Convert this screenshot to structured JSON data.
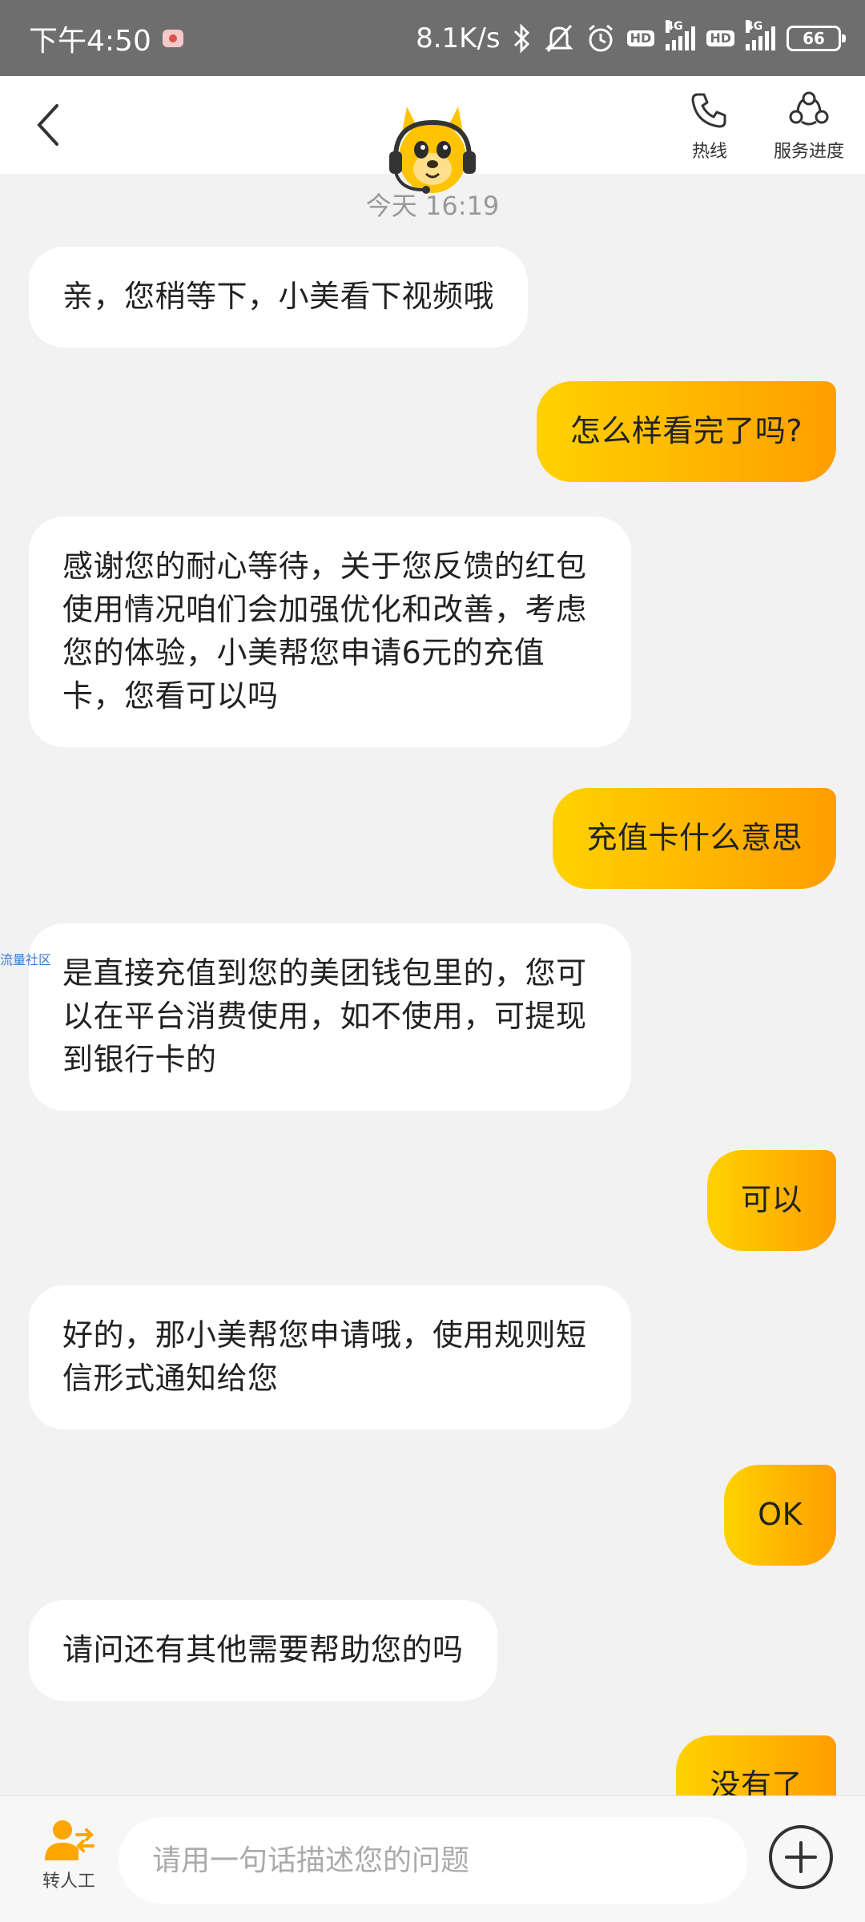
{
  "status_bar": {
    "time": "下午4:50",
    "net_speed": "8.1K/s",
    "sim1_type": "4G",
    "sim2_type": "4G",
    "hd_label": "HD",
    "battery": "66"
  },
  "header": {
    "hotline_label": "热线",
    "progress_label": "服务进度"
  },
  "chat": {
    "timestamp": "今天 16:19",
    "messages": [
      {
        "side": "in",
        "text": "亲，您稍等下，小美看下视频哦"
      },
      {
        "side": "out",
        "text": "怎么样看完了吗?"
      },
      {
        "side": "in",
        "text": "感谢您的耐心等待，关于您反馈的红包使用情况咱们会加强优化和改善，考虑您的体验，小美帮您申请6元的充值卡，您看可以吗"
      },
      {
        "side": "out",
        "text": "充值卡什么意思"
      },
      {
        "side": "in",
        "text": "是直接充值到您的美团钱包里的，您可以在平台消费使用，如不使用，可提现到银行卡的"
      },
      {
        "side": "out",
        "text": "可以"
      },
      {
        "side": "in",
        "text": "好的，那小美帮您申请哦，使用规则短信形式通知给您"
      },
      {
        "side": "out",
        "text": "OK"
      },
      {
        "side": "in",
        "text": "请问还有其他需要帮助您的吗"
      },
      {
        "side": "out",
        "text": "没有了"
      }
    ],
    "watermark": "流量社区"
  },
  "bottom_bar": {
    "transfer_label": "转人工",
    "input_placeholder": "请用一句话描述您的问题"
  },
  "colors": {
    "status_bar_bg": "#6e6e6e",
    "chat_bg": "#f2f2f2",
    "bubble_out_start": "#ffd200",
    "bubble_out_end": "#ff9e00",
    "accent": "#ffb300"
  },
  "icons": [
    "back-arrow-icon",
    "mascot-avatar",
    "phone-icon",
    "service-progress-icon",
    "transfer-agent-icon",
    "plus-circle-icon",
    "bluetooth-icon",
    "mute-icon",
    "alarm-icon"
  ]
}
